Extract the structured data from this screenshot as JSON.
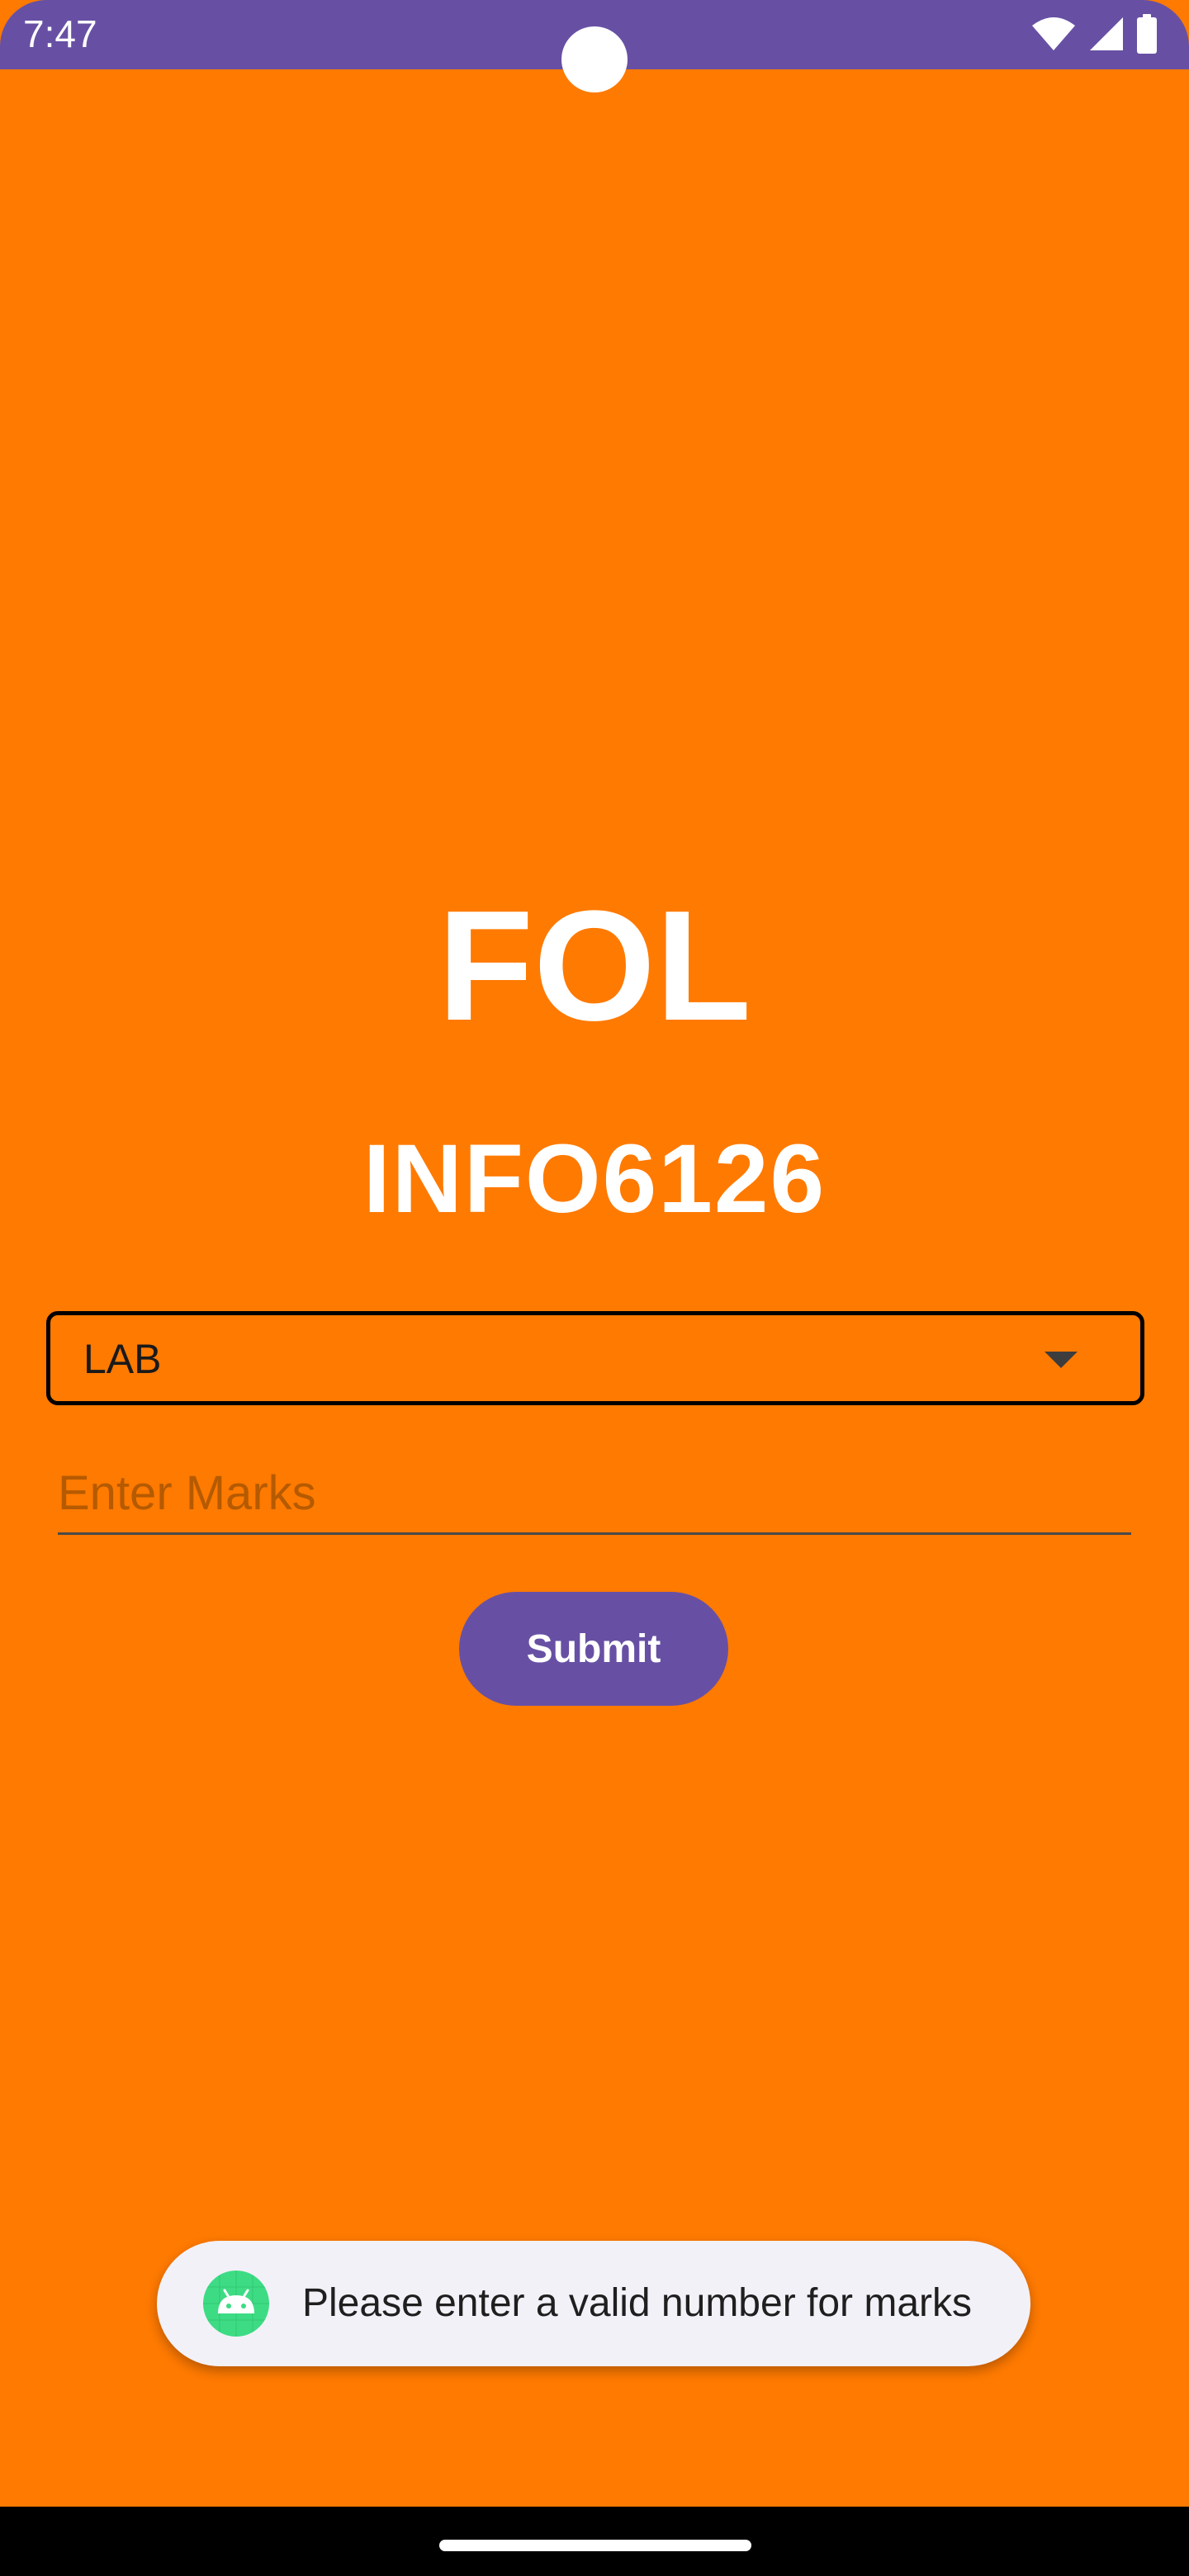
{
  "status_bar": {
    "time": "7:47",
    "color": "#6750a4",
    "icons": [
      "wifi-icon",
      "signal-icon",
      "battery-icon"
    ]
  },
  "theme": {
    "background": "#ff7a00",
    "accent": "#6750a4"
  },
  "main": {
    "title": "FOL",
    "course_code": "INFO6126",
    "dropdown": {
      "selected": "LAB"
    },
    "marks_input": {
      "value": "",
      "placeholder": "Enter Marks"
    },
    "submit_label": "Submit"
  },
  "toast": {
    "icon": "android-icon",
    "message": "Please enter a valid number for marks"
  }
}
